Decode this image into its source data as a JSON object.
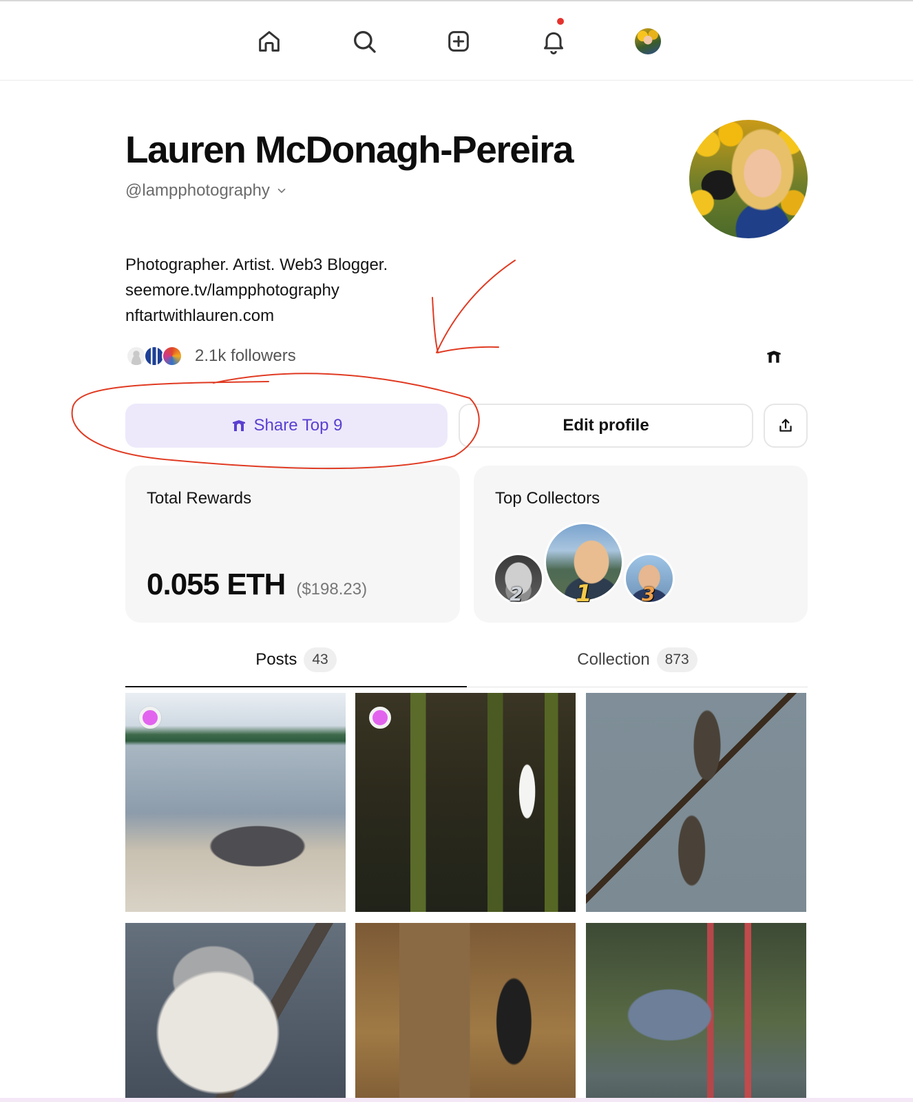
{
  "nav": {
    "items": [
      {
        "icon": "home-icon"
      },
      {
        "icon": "search-icon"
      },
      {
        "icon": "create-icon"
      },
      {
        "icon": "bell-icon",
        "has_notification": true
      },
      {
        "icon": "avatar"
      }
    ],
    "notification_color": "#e5322d"
  },
  "profile": {
    "name": "Lauren McDonagh-Pereira",
    "handle": "@lampphotography",
    "bio": [
      "Photographer. Artist. Web3 Blogger.",
      "seemore.tv/lampphotography",
      "nftartwithlauren.com"
    ],
    "followers": "2.1k followers"
  },
  "actions": {
    "share_top9": "Share Top 9",
    "edit_profile": "Edit profile",
    "accent": "#5b3fd0"
  },
  "rewards": {
    "title": "Total Rewards",
    "eth": "0.055 ETH",
    "usd": "($198.23)"
  },
  "collectors": {
    "title": "Top Collectors",
    "ranks": [
      "2",
      "1",
      "3"
    ]
  },
  "tabs": [
    {
      "label": "Posts",
      "count": "43",
      "active": true
    },
    {
      "label": "Collection",
      "count": "873",
      "active": false
    }
  ],
  "posts": [
    {
      "name": "post-gull",
      "has_dot": true
    },
    {
      "name": "post-egret",
      "has_dot": true
    },
    {
      "name": "post-ospreys",
      "has_dot": false
    },
    {
      "name": "post-titmouse",
      "has_dot": false
    },
    {
      "name": "post-woodpecker",
      "has_dot": false
    },
    {
      "name": "post-heron",
      "has_dot": false
    }
  ],
  "annotation_color": "#e03a22"
}
